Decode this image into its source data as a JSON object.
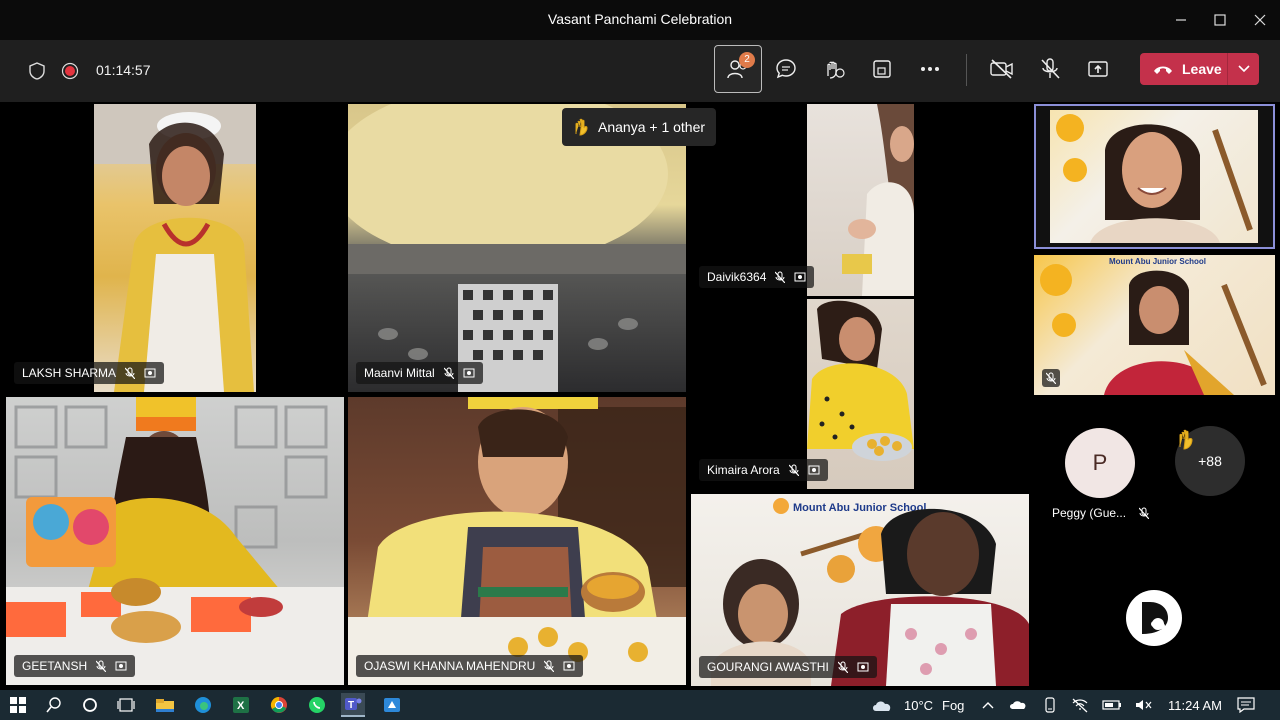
{
  "window": {
    "title": "Vasant Panchami Celebration",
    "controls": [
      "minimize-icon",
      "maximize-icon",
      "close-icon"
    ]
  },
  "toolbar": {
    "timer": "01:14:57",
    "participants_badge": "2",
    "leave_label": "Leave",
    "leave_color": "#c4314b",
    "accent": "#e07b4a"
  },
  "raise_toast": {
    "text": "Ananya + 1 other"
  },
  "tiles": [
    {
      "name": "LAKSH SHARMA"
    },
    {
      "name": "Maanvi Mittal"
    },
    {
      "name": "Daivik6364"
    },
    {
      "name": "Kimaira Arora"
    },
    {
      "name": "GEETANSH"
    },
    {
      "name": "OJASWI KHANNA MAHENDRU"
    },
    {
      "name": "GOURANGI AWASTHI"
    }
  ],
  "side": {
    "banner_text": "Mount Abu Junior School",
    "guest_initial": "P",
    "guest_name": "Peggy (Gue...",
    "overflow_count": "+88"
  },
  "taskbar": {
    "weather_temp": "10°C",
    "weather_desc": "Fog",
    "time": "11:24 AM",
    "apps": [
      "windows-start-icon",
      "search-icon",
      "cortana-icon",
      "task-view-icon",
      "file-explorer-icon",
      "edge-icon",
      "excel-icon",
      "chrome-icon",
      "whatsapp-icon",
      "teams-icon",
      "app-icon"
    ]
  }
}
